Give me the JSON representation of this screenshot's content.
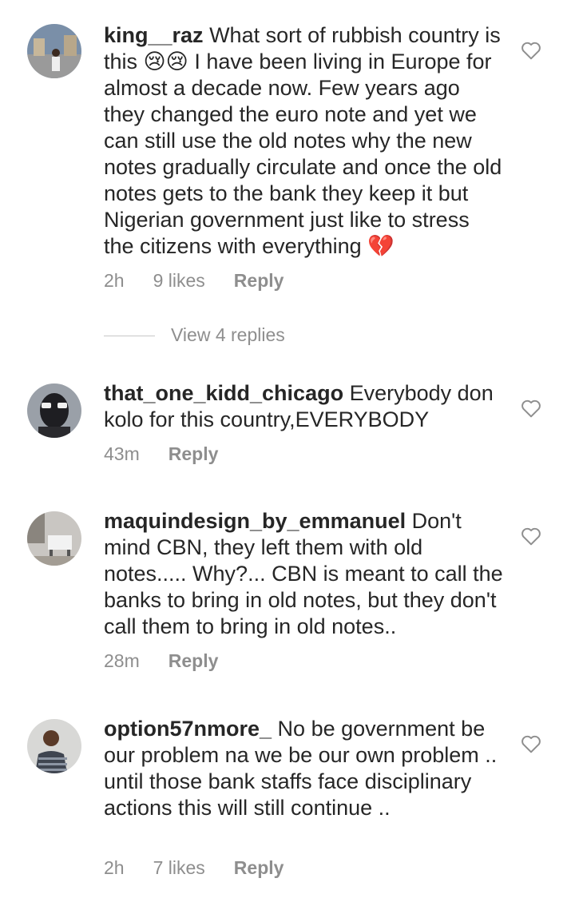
{
  "comments": [
    {
      "username": "king__raz",
      "text": "What sort of rubbish country is this 😢😢 I have been living in Europe for almost a decade now. Few years ago they changed the euro note and yet we can still use the old notes why the new notes gradually circulate and once the old notes gets to the bank they keep it but Nigerian government just like to stress the citizens with everything 💔",
      "time": "2h",
      "likes": "9 likes",
      "reply_label": "Reply",
      "view_replies": "View 4 replies"
    },
    {
      "username": "that_one_kidd_chicago",
      "text": "Everybody don kolo for this country,EVERYBODY",
      "time": "43m",
      "reply_label": "Reply"
    },
    {
      "username": "maquindesign_by_emmanuel",
      "text": "Don't mind CBN, they left them with old notes..... Why?... CBN is meant to call the banks to bring in old notes, but they don't call them to bring in old notes..",
      "time": "28m",
      "reply_label": "Reply"
    },
    {
      "username": "option57nmore_",
      "text": "No be government be our problem na we be our own problem .. until those bank staffs face disciplinary actions this will still continue ..",
      "time": "2h",
      "likes": "7 likes",
      "reply_label": "Reply"
    }
  ],
  "icons": {
    "like": "heart-outline-icon"
  }
}
